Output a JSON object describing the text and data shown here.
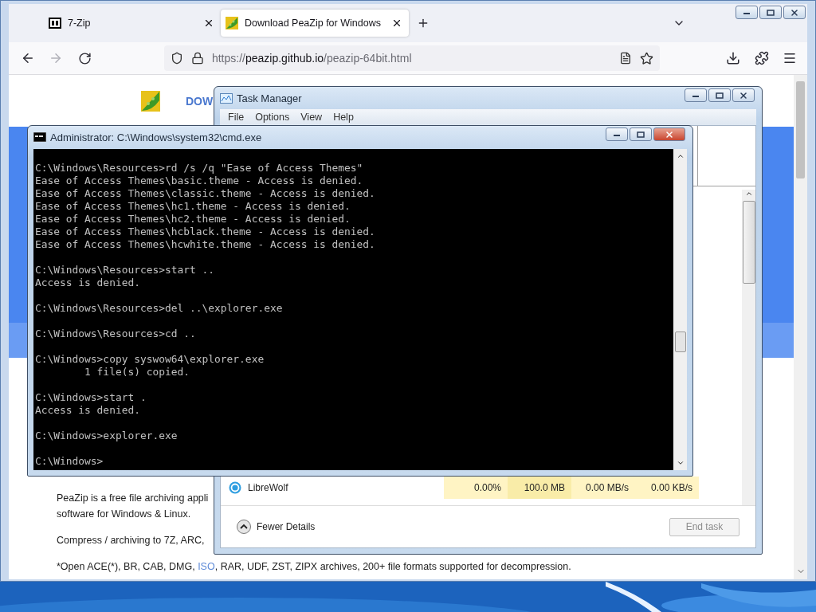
{
  "browser": {
    "tabs": [
      {
        "label": "7-Zip",
        "selected": false
      },
      {
        "label": "Download PeaZip for Windows",
        "selected": true
      }
    ],
    "forward_disabled": true,
    "url": {
      "scheme": "https://",
      "host": "peazip.github.io",
      "path": "/peazip-64bit.html"
    },
    "page": {
      "nav_link": "DOW",
      "paragraphs": [
        {
          "lines": [
            "PeaZip is a free file archiving appli",
            "software for Windows & Linux."
          ]
        },
        {
          "lines": [
            "Compress / archiving to 7Z, ARC,"
          ]
        },
        {
          "before": "*Open ACE(*), BR, CAB, DMG, ",
          "link": "ISO",
          "after": ", RAR, UDF, ZST, ZIPX archives, 200+ file formats supported for decompression."
        }
      ]
    }
  },
  "task_manager": {
    "title": "Task Manager",
    "menu": [
      "File",
      "Options",
      "View",
      "Help"
    ],
    "rows": [
      {
        "name": "LibreWolf",
        "cells": [
          "0.00%",
          "100.0 MB",
          "0.00 MB/s",
          "0.00 KB/s"
        ]
      }
    ],
    "fewer_details": "Fewer Details",
    "end_task": {
      "label": "End task",
      "disabled": true
    }
  },
  "cmd": {
    "title": "Administrator: C:\\Windows\\system32\\cmd.exe",
    "blocks": [
      [
        "C:\\Windows\\Resources>rd /s /q \"Ease of Access Themes\"",
        "Ease of Access Themes\\basic.theme - Access is denied.",
        "Ease of Access Themes\\classic.theme - Access is denied.",
        "Ease of Access Themes\\hc1.theme - Access is denied.",
        "Ease of Access Themes\\hc2.theme - Access is denied.",
        "Ease of Access Themes\\hcblack.theme - Access is denied.",
        "Ease of Access Themes\\hcwhite.theme - Access is denied."
      ],
      [
        "C:\\Windows\\Resources>start ..",
        "Access is denied."
      ],
      [
        "C:\\Windows\\Resources>del ..\\explorer.exe"
      ],
      [
        "C:\\Windows\\Resources>cd .."
      ],
      [
        "C:\\Windows>copy syswow64\\explorer.exe",
        "        1 file(s) copied."
      ],
      [
        "C:\\Windows>start .",
        "Access is denied."
      ],
      [
        "C:\\Windows>explorer.exe"
      ],
      [
        "C:\\Windows>"
      ]
    ]
  }
}
